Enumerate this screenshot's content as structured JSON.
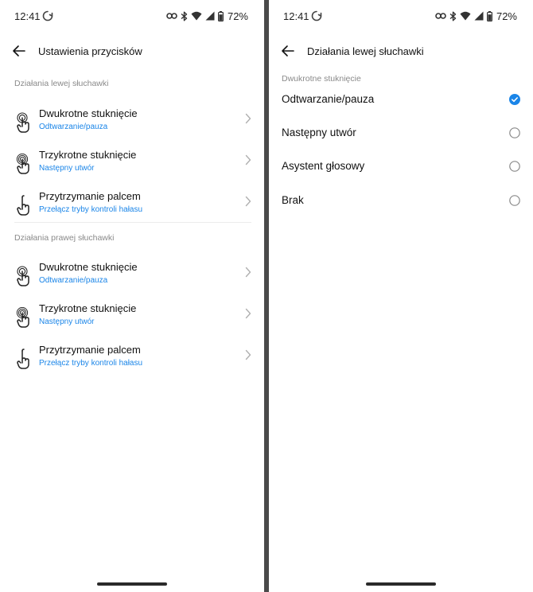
{
  "status_bar": {
    "time": "12:41",
    "battery": "72%"
  },
  "left_screen": {
    "title": "Ustawienia przycisków",
    "sections": [
      {
        "label": "Działania lewej słuchawki",
        "items": [
          {
            "title": "Dwukrotne stuknięcie",
            "value": "Odtwarzanie/pauza",
            "icon": "double-tap-icon"
          },
          {
            "title": "Trzykrotne stuknięcie",
            "value": "Następny utwór",
            "icon": "triple-tap-icon"
          },
          {
            "title": "Przytrzymanie palcem",
            "value": "Przełącz tryby kontroli hałasu",
            "icon": "press-hold-icon"
          }
        ]
      },
      {
        "label": "Działania prawej słuchawki",
        "items": [
          {
            "title": "Dwukrotne stuknięcie",
            "value": "Odtwarzanie/pauza",
            "icon": "double-tap-icon"
          },
          {
            "title": "Trzykrotne stuknięcie",
            "value": "Następny utwór",
            "icon": "triple-tap-icon"
          },
          {
            "title": "Przytrzymanie palcem",
            "value": "Przełącz tryby kontroli hałasu",
            "icon": "press-hold-icon"
          }
        ]
      }
    ]
  },
  "right_screen": {
    "title": "Działania lewej słuchawki",
    "section_label": "Dwukrotne stuknięcie",
    "options": [
      {
        "label": "Odtwarzanie/pauza",
        "selected": true
      },
      {
        "label": "Następny utwór",
        "selected": false
      },
      {
        "label": "Asystent głosowy",
        "selected": false
      },
      {
        "label": "Brak",
        "selected": false
      }
    ]
  },
  "colors": {
    "accent": "#1a85e8",
    "secondary_text": "#8a8a8a",
    "divider": "#ececec"
  }
}
